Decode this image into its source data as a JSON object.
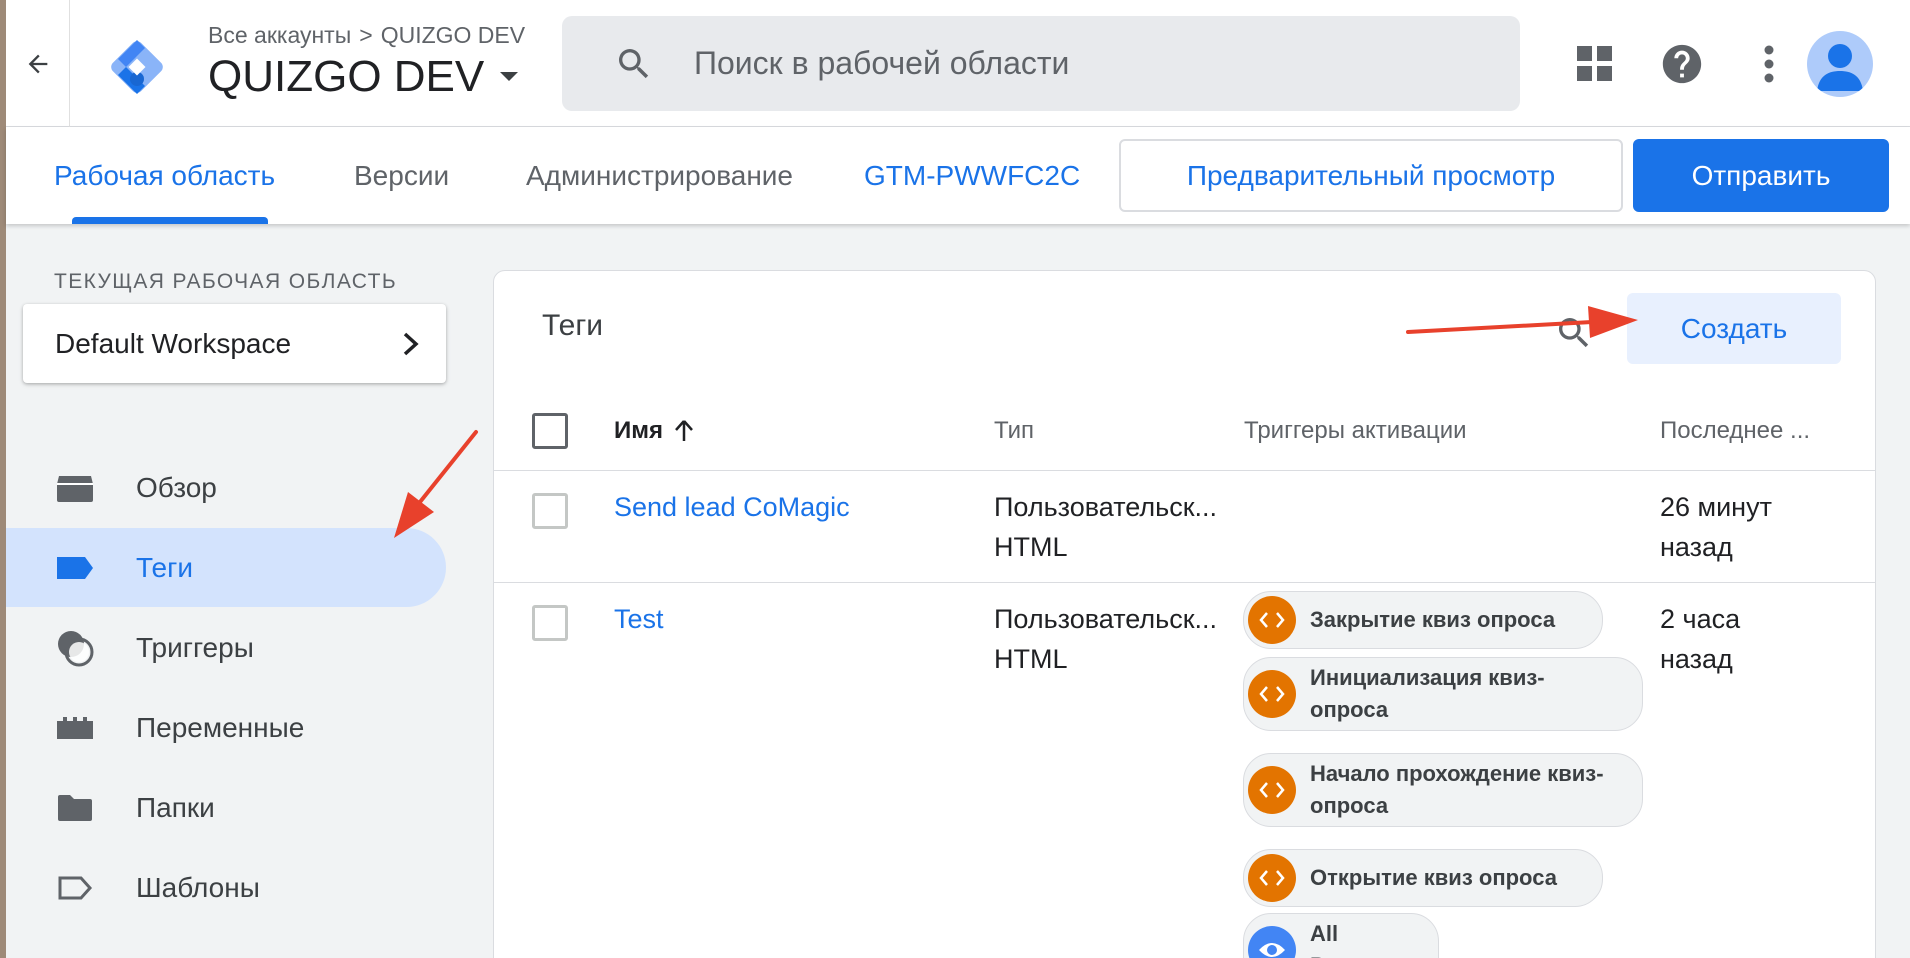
{
  "header": {
    "breadcrumb_accounts": "Все аккаунты",
    "breadcrumb_separator": ">",
    "breadcrumb_container": "QUIZGO DEV",
    "container_name": "QUIZGO DEV",
    "search_placeholder": "Поиск в рабочей области"
  },
  "nav": {
    "tabs": [
      {
        "label": "Рабочая область",
        "active": true
      },
      {
        "label": "Версии",
        "active": false
      },
      {
        "label": "Администрирование",
        "active": false
      }
    ],
    "container_id": "GTM-PWWFC2C",
    "preview_label": "Предварительный просмотр",
    "submit_label": "Отправить"
  },
  "sidebar": {
    "workspace_caption": "ТЕКУЩАЯ РАБОЧАЯ ОБЛАСТЬ",
    "workspace_name": "Default Workspace",
    "items": [
      {
        "label": "Обзор",
        "icon": "overview-icon",
        "active": false
      },
      {
        "label": "Теги",
        "icon": "tag-icon",
        "active": true
      },
      {
        "label": "Триггеры",
        "icon": "trigger-icon",
        "active": false
      },
      {
        "label": "Переменные",
        "icon": "variables-icon",
        "active": false
      },
      {
        "label": "Папки",
        "icon": "folder-icon",
        "active": false
      },
      {
        "label": "Шаблоны",
        "icon": "template-icon",
        "active": false
      }
    ]
  },
  "main": {
    "title": "Теги",
    "create_label": "Создать",
    "columns": {
      "name": "Имя",
      "type": "Тип",
      "triggers": "Триггеры активации",
      "last_edited": "Последнее ..."
    },
    "rows": [
      {
        "name": "Send lead CoMagic",
        "type_line1": "Пользовательск...",
        "type_line2": "HTML",
        "edited_line1": "26 минут",
        "edited_line2": "назад",
        "triggers": []
      },
      {
        "name": "Test",
        "type_line1": "Пользовательск...",
        "type_line2": "HTML",
        "edited_line1": "2 часа",
        "edited_line2": "назад",
        "triggers": [
          {
            "label": "Закрытие квиз опроса",
            "icon": "custom-event-icon"
          },
          {
            "label": "Инициализация квиз-опроса",
            "icon": "custom-event-icon"
          },
          {
            "label": "Начало прохождение квиз-опроса",
            "icon": "custom-event-icon"
          },
          {
            "label": "Открытие квиз опроса",
            "icon": "custom-event-icon"
          },
          {
            "label": "All Pages",
            "icon": "pageview-eye-icon"
          }
        ]
      }
    ]
  },
  "colors": {
    "accent": "#1a73e8",
    "active_nav_bg": "#d3e3fd",
    "custom_event_chip": "#e37400",
    "pageview_chip": "#4285f4",
    "annotation_arrow": "#e8412c"
  }
}
